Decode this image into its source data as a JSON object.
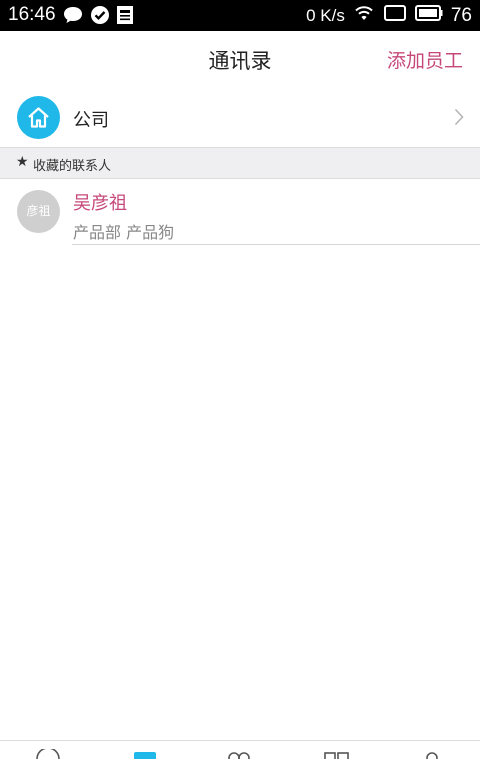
{
  "status_bar": {
    "time": "16:46",
    "network_speed": "0 K/s",
    "battery": "76",
    "icons": [
      "chat-bubble-icon",
      "check-circle-icon",
      "news-icon",
      "wifi-icon",
      "sim-icon",
      "battery-icon"
    ]
  },
  "header": {
    "title": "通讯录",
    "action_label": "添加员工",
    "accent_color": "#c6487a"
  },
  "company": {
    "label": "公司",
    "icon": "home-icon",
    "icon_bg": "#1fb8e8"
  },
  "favorites_section": {
    "star": "★",
    "label": "收藏的联系人"
  },
  "contacts": [
    {
      "avatar_text": "彦祖",
      "name": "吴彦祖",
      "department": "产品部 产品狗"
    }
  ],
  "tab_bar": {
    "tabs": [
      {
        "icon": "message-icon",
        "active": false
      },
      {
        "icon": "contacts-icon",
        "active": true
      },
      {
        "icon": "group-icon",
        "active": false
      },
      {
        "icon": "apps-icon",
        "active": false
      },
      {
        "icon": "profile-icon",
        "active": false
      }
    ]
  }
}
